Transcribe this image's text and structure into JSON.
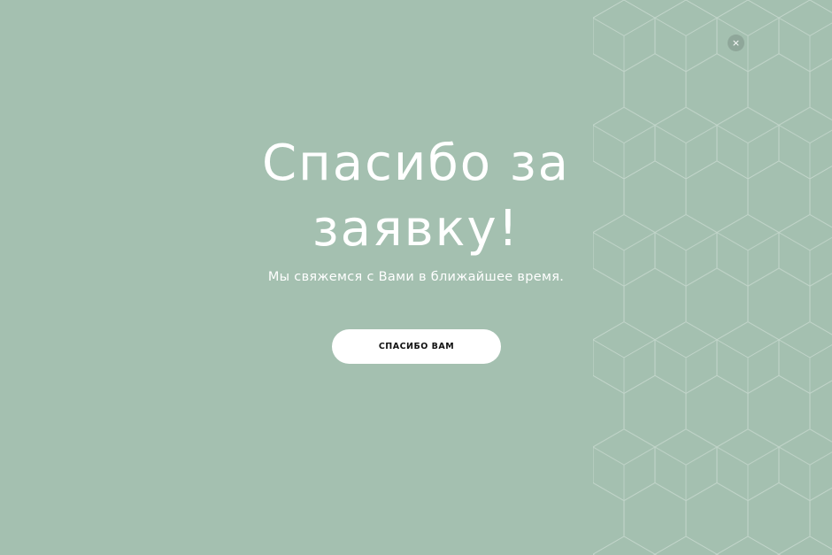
{
  "modal": {
    "title_line1": "Спасибо за",
    "title_line2": "заявку!",
    "subtitle": "Мы свяжемся с Вами в ближайшее время.",
    "button_label": "СПАСИБО ВАМ",
    "close_label": "×"
  },
  "colors": {
    "background": "#a4c0b0",
    "text": "#ffffff",
    "button_bg": "#ffffff",
    "button_text": "#111111",
    "close_bg": "#8fa79a"
  },
  "icons": {
    "close": "close-icon",
    "pattern": "hexagon-pattern"
  }
}
